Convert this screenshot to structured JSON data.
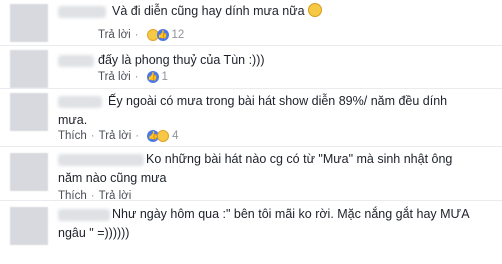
{
  "actions": {
    "like": "Thích",
    "reply": "Trả lời",
    "separator": "·"
  },
  "comments": [
    {
      "text": "Và đi diễn cũng hay dính mưa nữa",
      "has_emoji": true,
      "reaction_count": "12",
      "reactions": [
        "haha",
        "like"
      ]
    },
    {
      "text": "đấy là phong thuỷ của Tùn :)))",
      "has_emoji": false,
      "reaction_count": "1",
      "reactions": [
        "like"
      ]
    },
    {
      "text": "Ếy ngoài có mưa trong bài hát show diễn 89%/ năm đều dính\nmưa.",
      "has_emoji": false,
      "reaction_count": "4",
      "reactions": [
        "like",
        "haha"
      ]
    },
    {
      "text": "Ko những bài hát nào cg có từ \"Mưa\" mà sinh nhật ông\nnăm nào cũng mưa",
      "has_emoji": false,
      "reaction_count": "",
      "reactions": []
    },
    {
      "text": "Như ngày hôm qua :\" bên tôi mãi ko rời. Mặc nắng gắt hay MƯA\nngâu \" =))))))",
      "has_emoji": false,
      "reaction_count": "",
      "reactions": []
    }
  ]
}
